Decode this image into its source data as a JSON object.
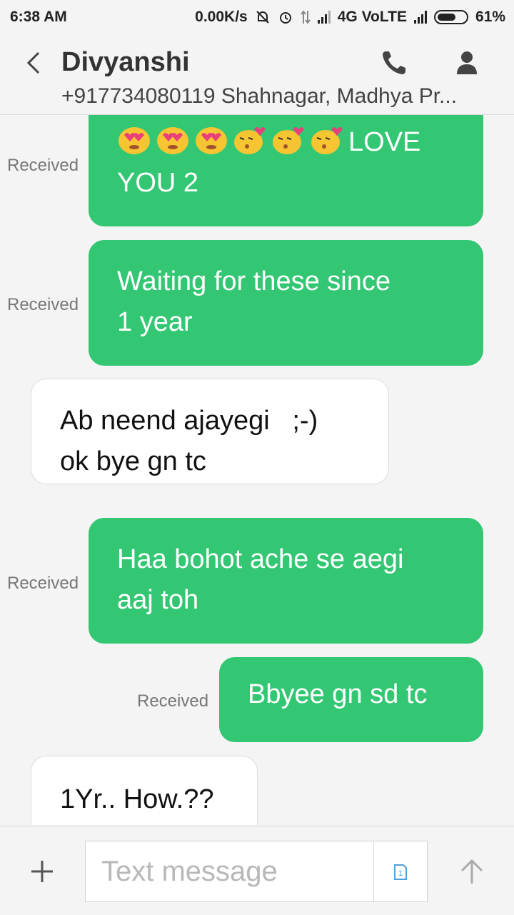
{
  "status_bar": {
    "time": "6:38 AM",
    "net_speed": "0.00K/s",
    "network": "4G VoLTE",
    "battery": "61%"
  },
  "header": {
    "contact_name": "Divyanshi",
    "contact_detail": "+917734080119 Shahnagar, Madhya Pr..."
  },
  "messages": [
    {
      "text_suffix": "LOVE",
      "text_line2": "YOU 2",
      "label": "Received"
    },
    {
      "line1": "Waiting for these since",
      "line2": "1 year",
      "label": "Received"
    },
    {
      "line1": "Ab neend ajayegi   ;-)",
      "line2": "ok bye gn tc"
    },
    {
      "line1": "Haa bohot ache se aegi",
      "line2": "aaj toh",
      "label": "Received"
    },
    {
      "line1": "Bbyee gn sd tc",
      "label": "Received"
    },
    {
      "line1": "1Yr.. How.??"
    }
  ],
  "composer": {
    "placeholder": "Text message",
    "sim_slot": "1"
  },
  "colors": {
    "bubble_green": "#33c773",
    "background": "#f4f4f4"
  }
}
